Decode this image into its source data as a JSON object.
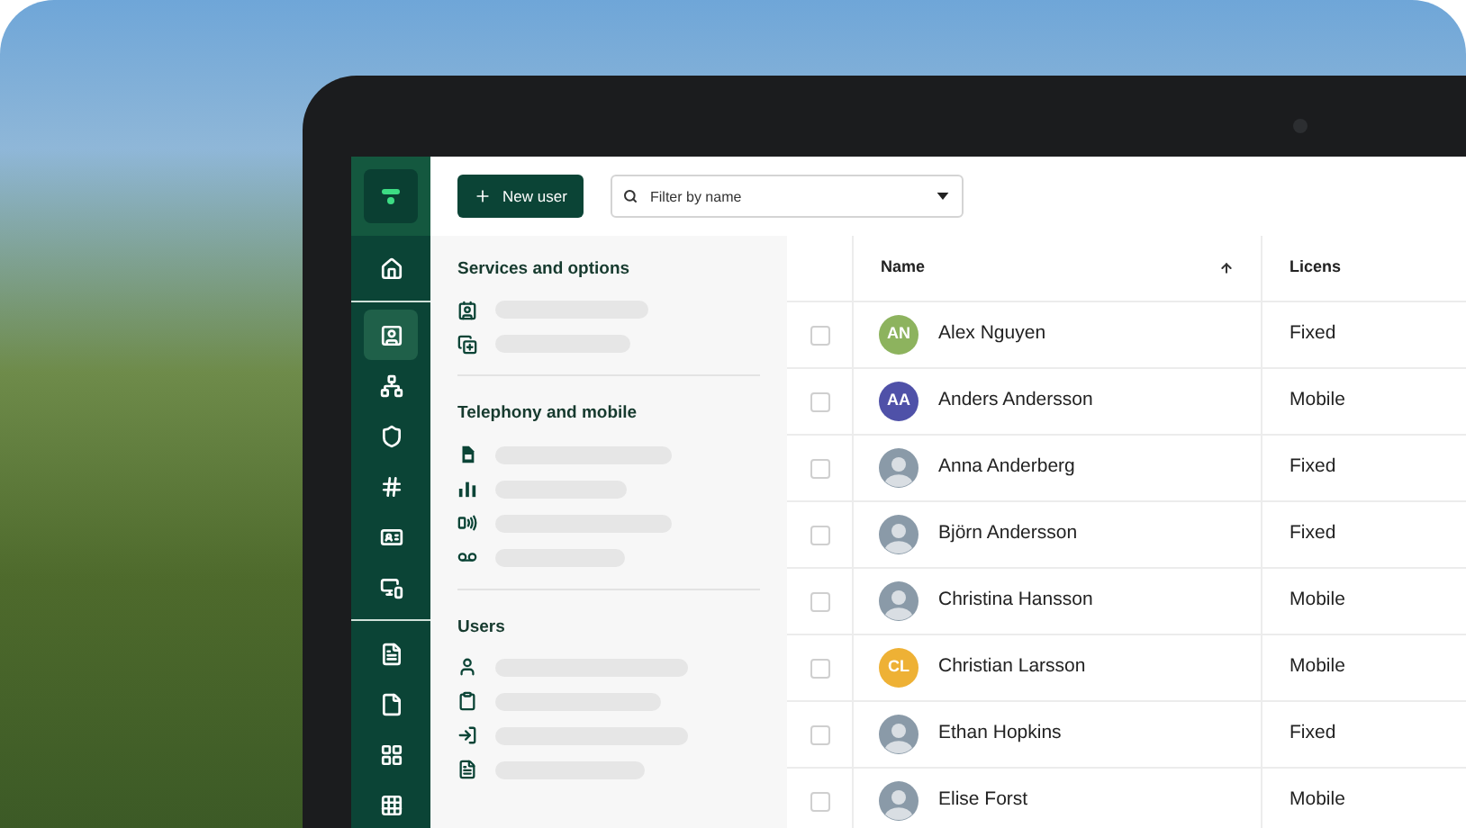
{
  "nav_groups": [
    {
      "items": [
        {
          "selected": false
        }
      ]
    },
    {
      "items": [
        {
          "selected": true
        },
        {
          "selected": false
        },
        {
          "selected": false
        },
        {
          "selected": false
        },
        {
          "selected": false
        },
        {
          "selected": false
        }
      ]
    },
    {
      "items": [
        {
          "selected": false
        },
        {
          "selected": false
        },
        {
          "selected": false
        },
        {
          "selected": false
        }
      ]
    }
  ],
  "toolbar": {
    "new_user_button": "New user",
    "filter": {
      "placeholder": "Filter by name"
    }
  },
  "panel_sections": [
    {
      "title": "Services and options",
      "items": [
        {
          "kind": "placeholder"
        },
        {
          "kind": "placeholder"
        }
      ]
    },
    {
      "title": "Telephony and mobile",
      "items": [
        {
          "kind": "placeholder"
        },
        {
          "kind": "placeholder"
        },
        {
          "kind": "placeholder"
        },
        {
          "kind": "placeholder"
        }
      ]
    },
    {
      "title": "Users",
      "items": [
        {
          "kind": "placeholder"
        },
        {
          "kind": "placeholder"
        },
        {
          "kind": "placeholder"
        },
        {
          "kind": "placeholder"
        }
      ]
    }
  ],
  "table": {
    "columns": {
      "name": {
        "label": "Name",
        "sorted": true
      },
      "license": {
        "label": "Licens"
      }
    },
    "rows": [
      {
        "checked": false,
        "name": "Alex Nguyen",
        "license": "Fixed",
        "avatar": {
          "kind": "initials",
          "initials": "AN",
          "color": "#8db35e"
        }
      },
      {
        "checked": false,
        "name": "Anders Andersson",
        "license": "Mobile",
        "avatar": {
          "kind": "initials",
          "initials": "AA",
          "color": "#4f51a8"
        }
      },
      {
        "checked": false,
        "name": "Anna Anderberg",
        "license": "Fixed",
        "avatar": {
          "kind": "photo"
        }
      },
      {
        "checked": false,
        "name": "Björn Andersson",
        "license": "Fixed",
        "avatar": {
          "kind": "photo"
        }
      },
      {
        "checked": false,
        "name": "Christina Hansson",
        "license": "Mobile",
        "avatar": {
          "kind": "photo"
        }
      },
      {
        "checked": false,
        "name": "Christian Larsson",
        "license": "Mobile",
        "avatar": {
          "kind": "initials",
          "initials": "CL",
          "color": "#eeb135"
        }
      },
      {
        "checked": false,
        "name": "Ethan Hopkins",
        "license": "Fixed",
        "avatar": {
          "kind": "photo"
        }
      },
      {
        "checked": false,
        "name": "Elise Forst",
        "license": "Mobile",
        "avatar": {
          "kind": "photo"
        }
      }
    ]
  }
}
